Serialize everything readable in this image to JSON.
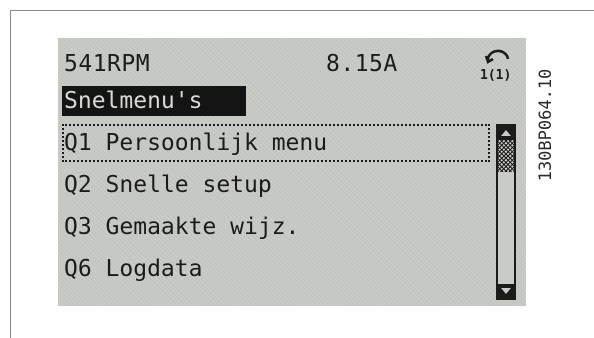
{
  "status": {
    "speed": "541RPM",
    "current": "8.15A",
    "setup_indicator": "1(1)"
  },
  "menu": {
    "title": "Snelmenu's",
    "items": [
      {
        "label": "Q1 Persoonlijk menu",
        "selected": true
      },
      {
        "label": "Q2 Snelle setup",
        "selected": false
      },
      {
        "label": "Q3 Gemaakte wijz.",
        "selected": false
      },
      {
        "label": "Q6 Logdata",
        "selected": false
      }
    ]
  },
  "reference_code": "130BP064.10",
  "icons": {
    "setup": "setup-cycle-icon",
    "scroll_up": "arrow-up-icon",
    "scroll_down": "arrow-down-icon"
  },
  "colors": {
    "lcd_background": "#c9cbc6",
    "lcd_text": "#1b1b1b",
    "title_bar": "#141414"
  }
}
